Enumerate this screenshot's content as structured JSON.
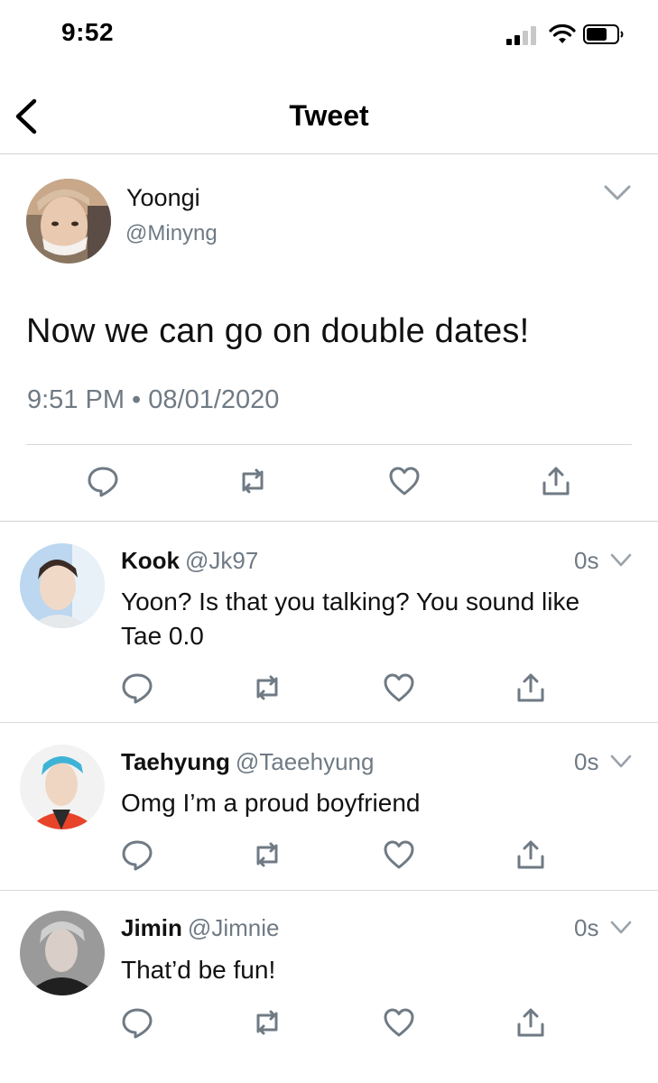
{
  "status_bar": {
    "time": "9:52"
  },
  "nav": {
    "title": "Tweet"
  },
  "main_tweet": {
    "name": "Yoongi",
    "handle": "@Minyng",
    "text": "Now we can go on double dates!",
    "meta": "9:51 PM • 08/01/2020"
  },
  "replies": [
    {
      "name": "Kook",
      "handle": "@Jk97",
      "time": "0s",
      "text": "Yoon? Is that you talking? You sound like Tae 0.0"
    },
    {
      "name": "Taehyung",
      "handle": "@Taeehyung",
      "time": "0s",
      "text": "Omg I’m a proud boyfriend"
    },
    {
      "name": "Jimin",
      "handle": "@Jimnie",
      "time": "0s",
      "text": "That’d be fun!"
    }
  ],
  "icons": {
    "reply": "reply-icon",
    "retweet": "retweet-icon",
    "like": "like-icon",
    "share": "share-icon"
  },
  "colors": {
    "muted": "#6f7a84",
    "icon": "#6f7a84",
    "divider": "#d5dadd"
  }
}
